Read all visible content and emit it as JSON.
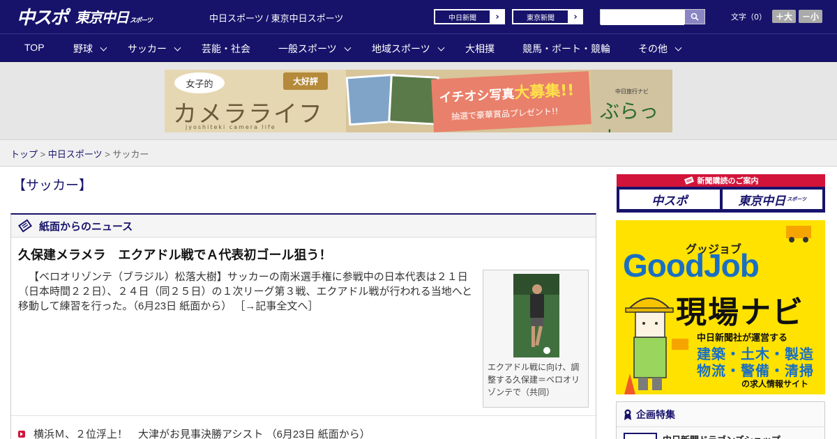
{
  "header": {
    "logo_main": "中スポ",
    "logo_tokyo": "東京中日",
    "logo_tokyo_small": "スポーツ",
    "site_links": "中日スポーツ / 東京中日スポーツ",
    "paper1": "中日新聞",
    "paper2": "東京新聞",
    "search_placeholder": "",
    "font_label": "文字（0）",
    "font_bigger": "＋大",
    "font_smaller": "－小",
    "brand_color": "#17136b"
  },
  "nav": {
    "items": [
      {
        "label": "TOP"
      },
      {
        "label": "野球"
      },
      {
        "label": "サッカー"
      },
      {
        "label": "芸能・社会"
      },
      {
        "label": "一般スポーツ"
      },
      {
        "label": "地域スポーツ"
      },
      {
        "label": "大相撲"
      },
      {
        "label": "競馬・ボート・競輪"
      },
      {
        "label": "その他"
      }
    ]
  },
  "banner": {
    "bubble": "女子的",
    "title": "カメラライフ",
    "tag": "大好評",
    "sub": "jyoshiteki camera life",
    "pink_line1_a": "イチオシ写真",
    "pink_line1_b": "大募集!!",
    "pink_line2": "抽選で豪華賞品プレゼント!!",
    "right_nav": "中日旅行ナビ",
    "right_brand": "ぶらっ人"
  },
  "breadcrumb": {
    "top": "トップ",
    "sep1": " > ",
    "paper": "中日スポーツ",
    "sep2": " > ",
    "current": "サッカー"
  },
  "main": {
    "section_title": "【サッカー】",
    "news_heading": "紙面からのニュース",
    "headline": "久保建メラメラ　エクアドル戦でＡ代表初ゴール狙う！",
    "body": "【ベロオリゾンテ（ブラジル）松落大樹】サッカーの南米選手権に参戦中の日本代表は２１日（日本時間２２日）、２４日（同２５日）の１次リーグ第３戦、エクアドル戦が行われる当地へと移動して練習を行った。（6月23日 紙面から）",
    "read_more": "［→記事全文へ］",
    "caption": "エクアドル戦に向け、調整する久保建＝ベロオリゾンテで（共同）",
    "list_item": "横浜Ｍ、２位浮上！　大津がお見事決勝アシスト （6月23日 紙面から）"
  },
  "sidebar": {
    "sub_head": "新聞購読のご案内",
    "sub_logo1": "中スポ",
    "sub_logo2": "東京中日",
    "sub_logo2_small": "スポーツ",
    "gj_sub": "グッジョブ",
    "gj_main": "GoodJob",
    "gj_title": "現場ナビ",
    "gj_line1": "中日新聞社が運営する",
    "gj_line2": "建築・土木・製造",
    "gj_line3": "物流・警備・清掃",
    "gj_line4": "の求人情報サイト",
    "feat_head": "企画特集",
    "feat_item": "中日新聞ドラゴンズショップ"
  }
}
